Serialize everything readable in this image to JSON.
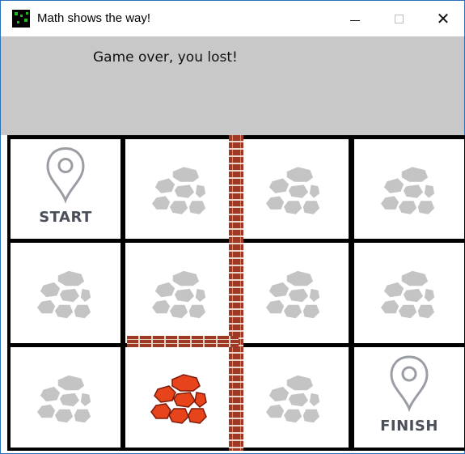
{
  "window": {
    "title": "Math shows the way!",
    "icon": "app-icon",
    "controls": [
      "minimize-icon",
      "maximize-icon",
      "close-icon"
    ]
  },
  "status": {
    "message": "Game over, you lost!"
  },
  "board": {
    "rows": 3,
    "cols": 4,
    "cells": [
      [
        {
          "type": "start",
          "label": "START"
        },
        {
          "type": "stones"
        },
        {
          "type": "stones"
        },
        {
          "type": "stones"
        }
      ],
      [
        {
          "type": "stones"
        },
        {
          "type": "stones"
        },
        {
          "type": "stones"
        },
        {
          "type": "stones"
        }
      ],
      [
        {
          "type": "stones"
        },
        {
          "type": "stones-hit"
        },
        {
          "type": "stones"
        },
        {
          "type": "finish",
          "label": "FINISH"
        }
      ]
    ],
    "walls": [
      {
        "orientation": "vertical",
        "between_cols": [
          1,
          2
        ],
        "rows": [
          0,
          1,
          2
        ]
      },
      {
        "orientation": "horizontal",
        "between_rows": [
          1,
          2
        ],
        "col": 1
      }
    ]
  },
  "colors": {
    "status_panel": "#c8c8c8",
    "stones": "#c4c4c4",
    "stones_hit": "#e8441c",
    "brick": "#9e3a24",
    "marker": "#4a4f5a"
  }
}
